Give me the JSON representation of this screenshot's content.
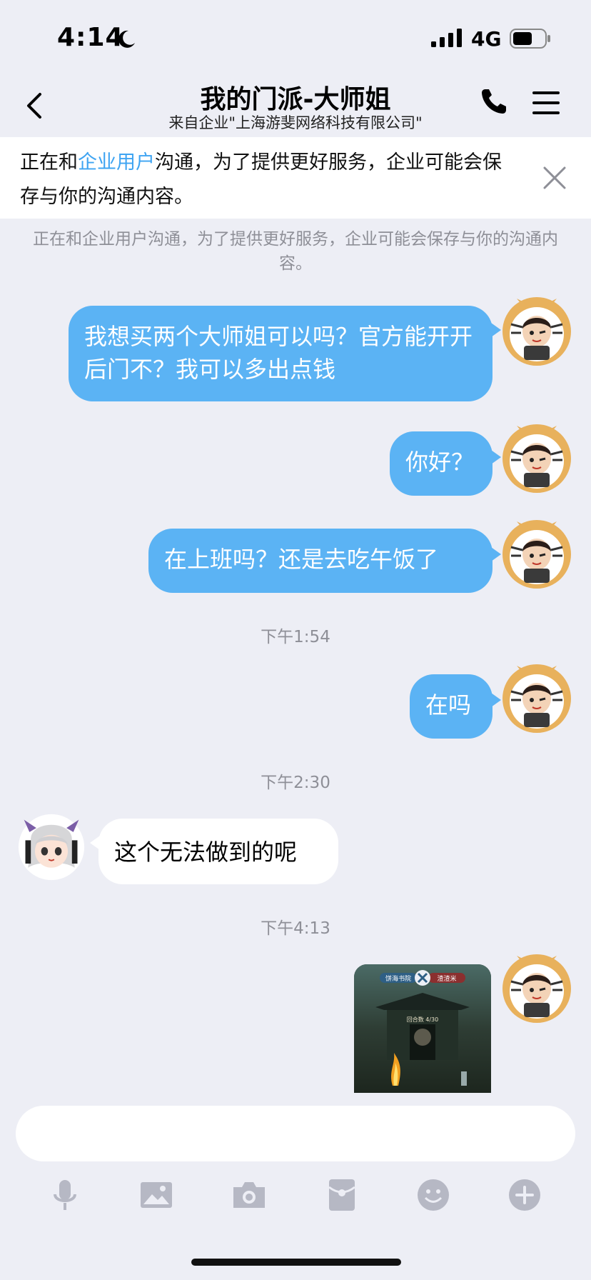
{
  "status": {
    "time": "4:14",
    "network": "4G"
  },
  "header": {
    "title": "我的门派-大师姐",
    "subtitle": "来自企业\"上海游斐网络科技有限公司\""
  },
  "notice": {
    "prefix": "正在和",
    "link": "企业用户",
    "suffix": "沟通，为了提供更好服务，企业可能会保存与你的沟通内容。"
  },
  "system_message": "正在和企业用户沟通，为了提供更好服务，企业可能会保存与你的沟通内容。",
  "messages": [
    {
      "text": "我想买两个大师姐可以吗？官方能开开后门不？我可以多出点钱"
    },
    {
      "text": "你好？"
    },
    {
      "text": "在上班吗？还是去吃午饭了"
    },
    {
      "time": "下午1:54"
    },
    {
      "text": "在吗"
    },
    {
      "time": "下午2:30"
    },
    {
      "text": "这个无法做到的呢"
    },
    {
      "time": "下午4:13"
    },
    {
      "image": "game-screenshot"
    }
  ],
  "game_image": {
    "left_label": "饼海书院",
    "right_label": "渣渣米",
    "round": "回合数 4/30"
  },
  "composer": {
    "placeholder": ""
  },
  "toolbar": [
    "mic-icon",
    "image-icon",
    "camera-icon",
    "red-packet-icon",
    "emoji-icon",
    "plus-icon"
  ],
  "colors": {
    "bubble_out": "#5bb3f4",
    "link": "#3ea4f2",
    "background": "#edeef5"
  }
}
